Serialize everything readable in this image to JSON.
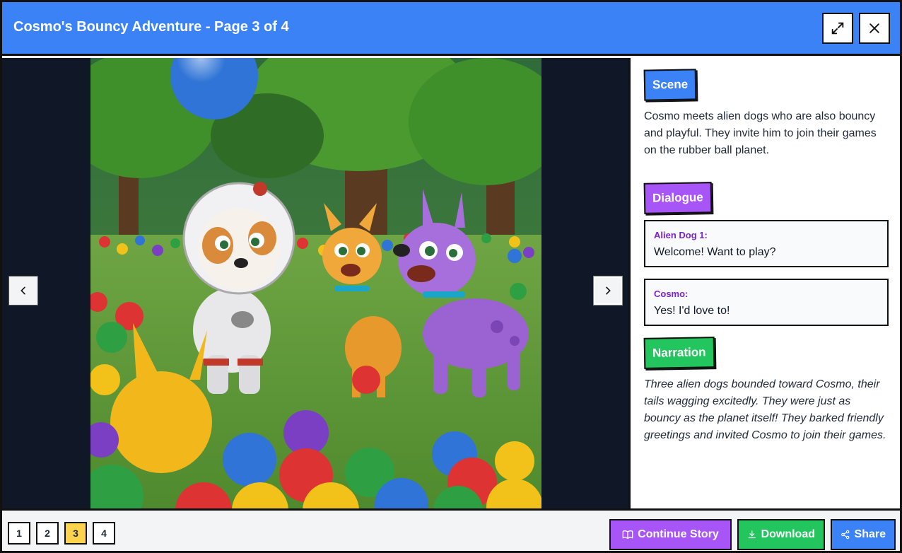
{
  "header": {
    "title": "Cosmo's Bouncy Adventure - Page 3 of 4",
    "expand_icon": "expand-icon",
    "close_icon": "close-icon"
  },
  "viewer": {
    "prev_icon": "chevron-left-icon",
    "next_icon": "chevron-right-icon",
    "illustration": "Cartoon astronaut puppy with two alien dogs (orange and purple) on a grassy field full of colorful balls"
  },
  "panel": {
    "scene": {
      "label": "Scene",
      "text": "Cosmo meets alien dogs who are also bouncy and playful. They invite him to join their games on the rubber ball planet."
    },
    "dialogue": {
      "label": "Dialogue",
      "lines": [
        {
          "speaker": "Alien Dog 1:",
          "text": "Welcome! Want to play?"
        },
        {
          "speaker": "Cosmo:",
          "text": "Yes! I'd love to!"
        }
      ]
    },
    "narration": {
      "label": "Narration",
      "text": "Three alien dogs bounded toward Cosmo, their tails wagging excitedly. They were just as bouncy as the planet itself! They barked friendly greetings and invited Cosmo to join their games."
    }
  },
  "footer": {
    "pages": [
      "1",
      "2",
      "3",
      "4"
    ],
    "current_page": "3",
    "continue_label": "Continue Story",
    "download_label": "Download",
    "share_label": "Share"
  },
  "colors": {
    "header_bg": "#3b82f6",
    "scene_tag": "#3b82f6",
    "dialogue_tag": "#a855f7",
    "narration_tag": "#22c55e",
    "active_page": "#fcd34d"
  }
}
